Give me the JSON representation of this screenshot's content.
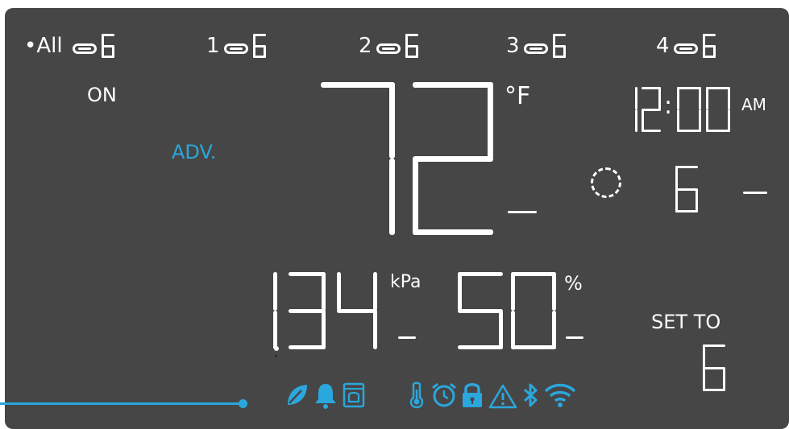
{
  "display": {
    "outlets": [
      {
        "label": "•All",
        "digit": "6"
      },
      {
        "label": "1",
        "digit": "6"
      },
      {
        "label": "2",
        "digit": "6"
      },
      {
        "label": "3",
        "digit": "6"
      },
      {
        "label": "4",
        "digit": "6"
      }
    ],
    "mode": {
      "state": "ON",
      "program": "ADV."
    },
    "temperature": {
      "value": "72",
      "unit": "°F"
    },
    "clock": {
      "time": "12:00",
      "period": "AM"
    },
    "timer": {
      "digit": "6"
    },
    "vpd": {
      "value": "1.34",
      "unit": "kPa"
    },
    "humidity": {
      "value": "50",
      "unit": "%"
    },
    "set_to": {
      "label": "SET TO",
      "digit": "6"
    },
    "colors": {
      "panel": "#464646",
      "accent": "#2aa7dc",
      "segment": "#ffffff"
    },
    "status_icons": [
      "leaf-icon",
      "bell-icon",
      "device-icon",
      "thermometer-icon",
      "alarm-clock-icon",
      "lock-icon",
      "warning-icon",
      "bluetooth-icon",
      "wifi-icon"
    ]
  }
}
